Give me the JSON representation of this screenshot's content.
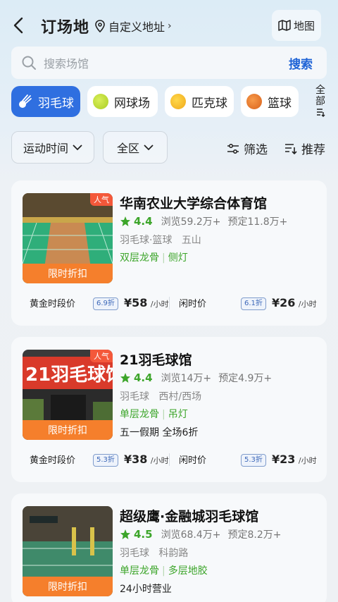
{
  "header": {
    "title": "订场地",
    "location_label": "自定义地址",
    "location_chevron": "›",
    "map_label": "地图"
  },
  "search": {
    "placeholder": "搜索场馆",
    "button_label": "搜索"
  },
  "categories": [
    {
      "label": "羽毛球",
      "icon": "badminton-icon",
      "active": true
    },
    {
      "label": "网球场",
      "icon": "tennis-ball-icon",
      "active": false
    },
    {
      "label": "匹克球",
      "icon": "pickleball-icon",
      "active": false
    },
    {
      "label": "篮球",
      "icon": "basketball-icon",
      "active": false
    }
  ],
  "all_categories": {
    "line1": "全",
    "line2": "部"
  },
  "filters": {
    "time_label": "运动时间",
    "area_label": "全区",
    "filter_label": "筛选",
    "sort_label": "推荐"
  },
  "colors": {
    "accent": "#2f6fe0",
    "green": "#3ca52a",
    "promo": "#f57f2c",
    "hot": "#f4583a"
  },
  "venues": [
    {
      "hot_badge": "人气",
      "promo": "限时折扣",
      "name": "华南农业大学综合体育馆",
      "rating": "4.4",
      "views": "浏览59.2万+",
      "bookings": "预定11.8万+",
      "tags": "羽毛球·篮球",
      "area": "五山",
      "feature1": "双层龙骨",
      "feature2": "侧灯",
      "note": "",
      "peak_label": "黄金时段价",
      "peak_discount": "6.9折",
      "peak_price": "¥58",
      "peak_unit": "/小时",
      "idle_label": "闲时价",
      "idle_discount": "6.1折",
      "idle_price": "¥26",
      "idle_unit": "/小时"
    },
    {
      "hot_badge": "人气",
      "promo": "限时折扣",
      "name": "21羽毛球馆",
      "rating": "4.4",
      "views": "浏览14万+",
      "bookings": "预定4.9万+",
      "tags": "羽毛球",
      "area": "西村/西场",
      "feature1": "单层龙骨",
      "feature2": "吊灯",
      "note": "五一假期 全场6折",
      "peak_label": "黄金时段价",
      "peak_discount": "5.3折",
      "peak_price": "¥38",
      "peak_unit": "/小时",
      "idle_label": "闲时价",
      "idle_discount": "5.3折",
      "idle_price": "¥23",
      "idle_unit": "/小时"
    },
    {
      "promo": "限时折扣",
      "name": "超级鹰·金融城羽毛球馆",
      "rating": "4.5",
      "views": "浏览68.4万+",
      "bookings": "预定8.2万+",
      "tags": "羽毛球",
      "area": "科韵路",
      "feature1": "单层龙骨",
      "feature2": "多层地胶",
      "note": "24小时营业"
    }
  ]
}
